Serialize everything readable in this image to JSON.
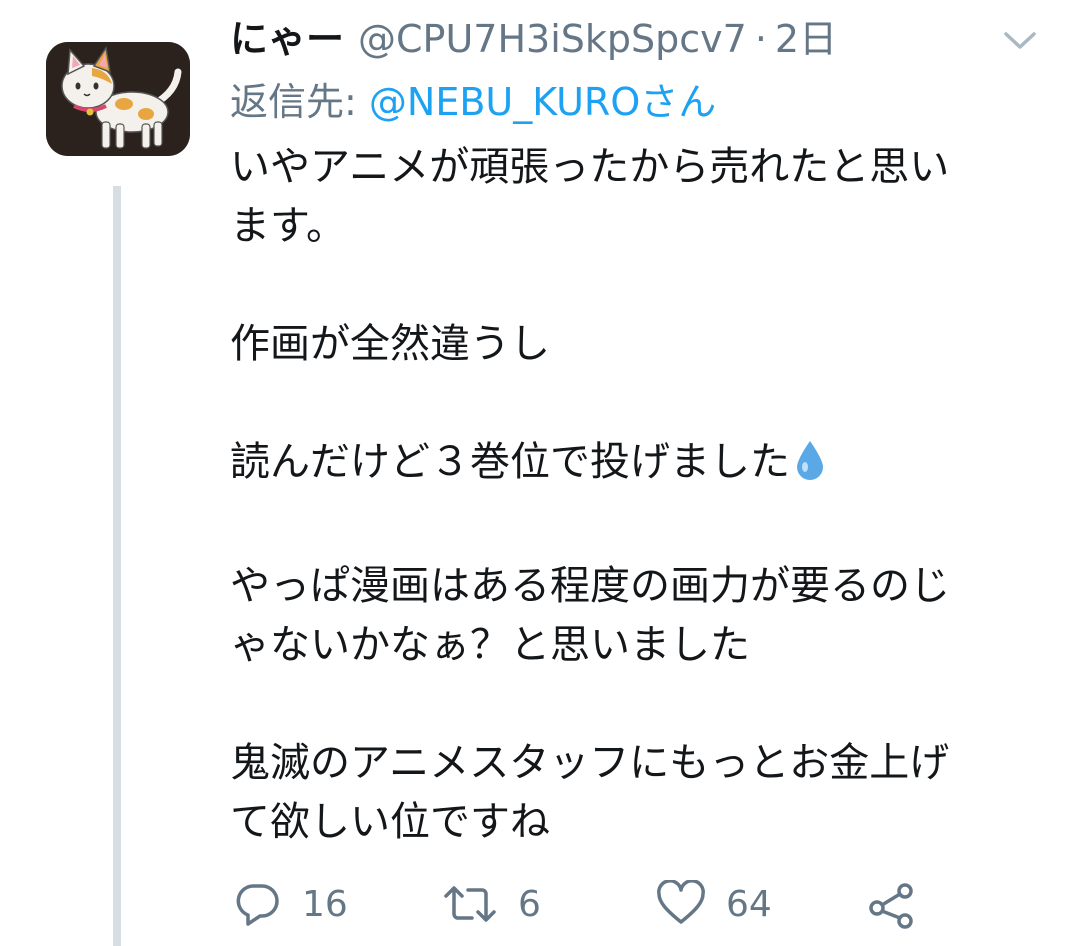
{
  "tweet": {
    "author": {
      "display_name": "にゃー",
      "handle": "@CPU7H3iSkpSpcv7",
      "separator": "·",
      "time": "2日",
      "avatar_icon": "calico-cat-avatar"
    },
    "menu_icon": "chevron-down-icon",
    "reply_to": {
      "prefix": "返信先:",
      "mention": "@NEBU_KUROさん"
    },
    "paragraphs": [
      "いやアニメが頑張ったから売れたと思い\nます。",
      "作画が全然違うし",
      "読んだけど３巻位で投げました",
      "やっぱ漫画はある程度の画力が要るのじ\nゃないかなぁ？と思いました",
      "鬼滅のアニメスタッフにもっとお金上げ\nて欲しい位ですね"
    ],
    "emoji": "droplet-emoji",
    "actions": {
      "reply": {
        "icon": "reply-icon",
        "count": "16"
      },
      "retweet": {
        "icon": "retweet-icon",
        "count": "6"
      },
      "like": {
        "icon": "heart-icon",
        "count": "64"
      },
      "share": {
        "icon": "share-icon"
      }
    }
  },
  "colors": {
    "text": "#14171a",
    "secondary": "#657786",
    "link": "#1da1f2",
    "thread_line": "#d6dee4",
    "emoji_drop": "#5aa9e6"
  }
}
